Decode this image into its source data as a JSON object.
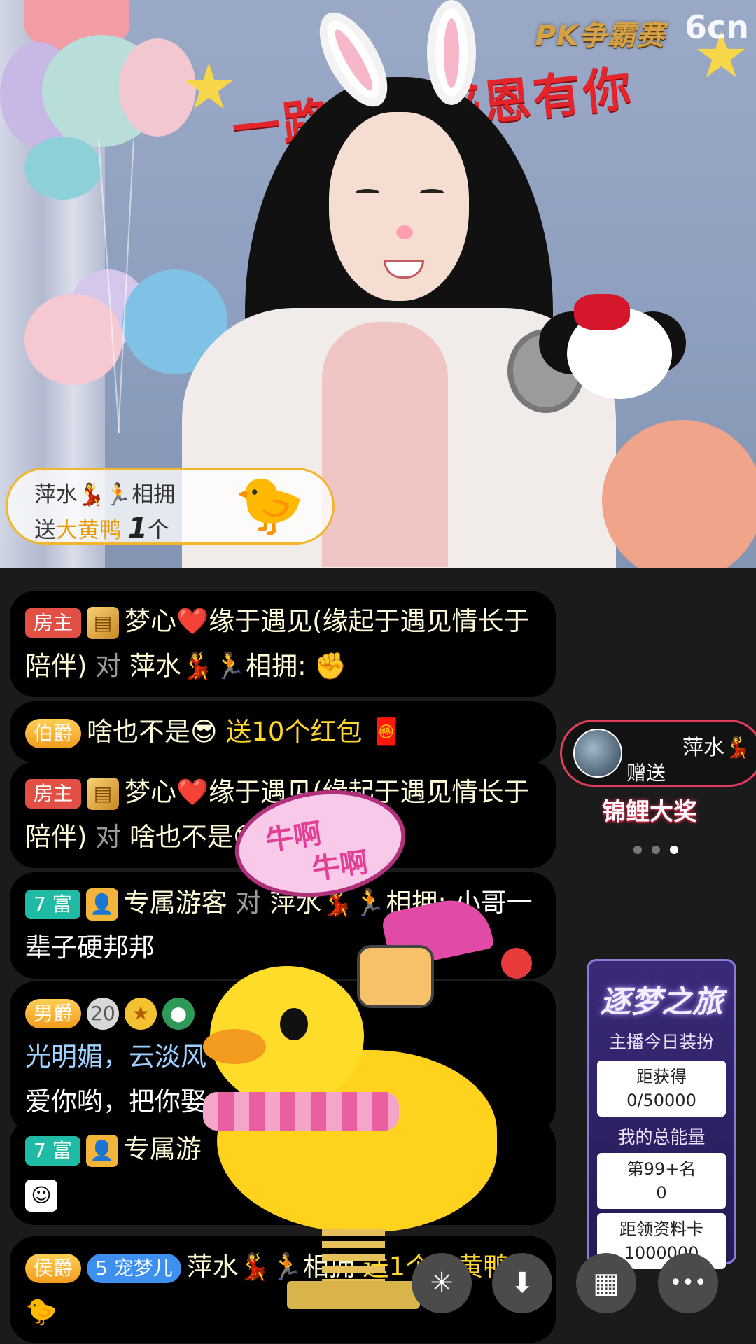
{
  "logo": {
    "pk": "PK争霸赛",
    "site": "6cn"
  },
  "banner": {
    "text": "一路陪伴感恩有你"
  },
  "gift_notice": {
    "sender": "萍水💃🏃相拥",
    "prefix": "送",
    "gift": "大黄鸭",
    "count": "1",
    "unit": "个"
  },
  "chat": [
    {
      "badge": "房主",
      "icon": "gold-card-icon",
      "user": "梦心❤️缘于遇见(缘起于遇见情长于陪伴)",
      "connector": "对",
      "target": "萍水💃🏃相拥:",
      "content": "✊"
    },
    {
      "badge": "伯爵",
      "user": "啥也不是😎",
      "content": "送10个红包",
      "emoji": "🧧"
    },
    {
      "badge": "房主",
      "user": "梦心❤️缘于遇见(缘起于遇见情长于陪伴)",
      "connector": "对",
      "target": "啥也不是😎:"
    },
    {
      "badge": "7 富",
      "user": "专属游客",
      "connector": "对",
      "target": "萍水💃🏃相拥:",
      "content": "小哥一辈子硬邦邦"
    },
    {
      "badge": "男爵",
      "level": "20",
      "user": "光明媚，云淡风",
      "content": "爱你哟，把你娶"
    },
    {
      "badge": "7 富",
      "user": "专属游"
    },
    {
      "badge": "侯爵",
      "fan_badge": "宠梦儿",
      "fan_level": "5",
      "user": "萍水💃🏃相拥",
      "content": "送1个大黄鸭"
    }
  ],
  "gift_pill": {
    "name": "萍水💃",
    "action": "赠送",
    "banner": "锦鲤大奖"
  },
  "carousel": {
    "count": 3,
    "active": 2
  },
  "dream": {
    "title": "逐梦之旅",
    "subtitle": "主播今日装扮",
    "need_label": "距获得",
    "need_value": "0/50000",
    "energy_label": "我的总能量",
    "rank": "第99+名",
    "energy_value": "0",
    "card_label": "距领资料卡",
    "card_value": "1000000"
  },
  "bubble": {
    "line1": "牛啊",
    "line2": "牛啊"
  },
  "buttons": {
    "effects": "✳",
    "download": "⬇",
    "grid": "▦",
    "more": "•••"
  },
  "colors": {
    "accent_gold": "#ffd52e",
    "chat_bg": "#000000",
    "pill_border": "#e23e5c"
  }
}
